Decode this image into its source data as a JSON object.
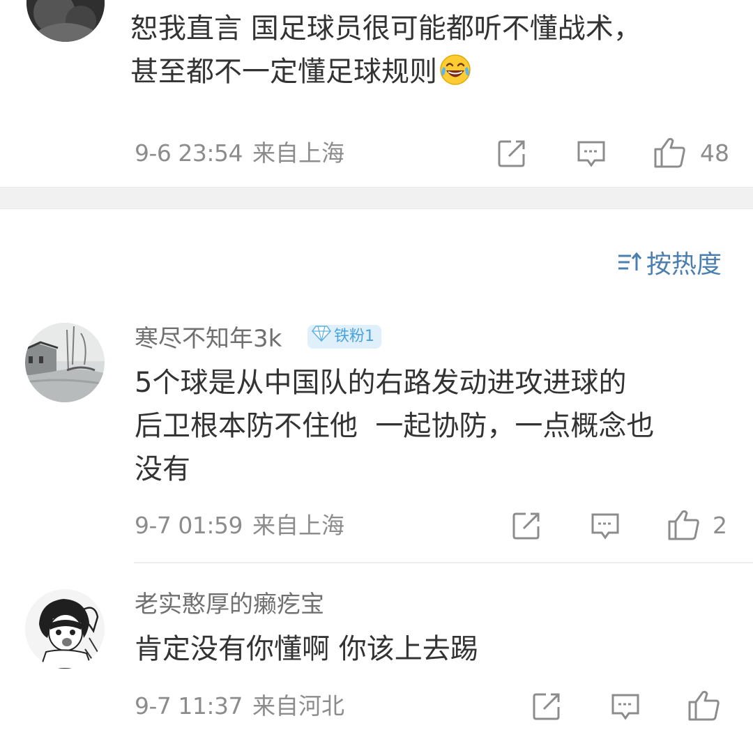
{
  "comments": [
    {
      "username": "",
      "lines": [
        "恕我直言 国足球员很可能都听不懂战术，",
        "甚至都不一定懂足球规则"
      ],
      "emoji": "laughing-tears-emoji",
      "time": "9-6 23:54",
      "location": "来自上海",
      "likes": "48"
    },
    {
      "username": "寒尽不知年3k",
      "badge": "铁粉1",
      "lines": [
        "5个球是从中国队的右路发动进攻进球的",
        "后卫根本防不住他  一起协防，一点概念也",
        "没有"
      ],
      "time": "9-7 01:59",
      "location": "来自上海",
      "likes": "2"
    },
    {
      "username": "老实憨厚的癞疙宝",
      "lines": [
        "肯定没有你懂啊 你该上去踢"
      ],
      "time": "9-7 11:37",
      "location": "来自河北",
      "likes": ""
    }
  ],
  "sort": {
    "label": "按热度",
    "icon": "sort-icon"
  },
  "icons": {
    "share": "share-icon",
    "reply": "reply-icon",
    "like": "thumbs-up-icon",
    "badge": "diamond-icon"
  },
  "colors": {
    "link": "#4a7fb0",
    "badge_bg": "#dff0fb",
    "badge_text": "#4aa3df",
    "meta": "#8c8c8c"
  }
}
